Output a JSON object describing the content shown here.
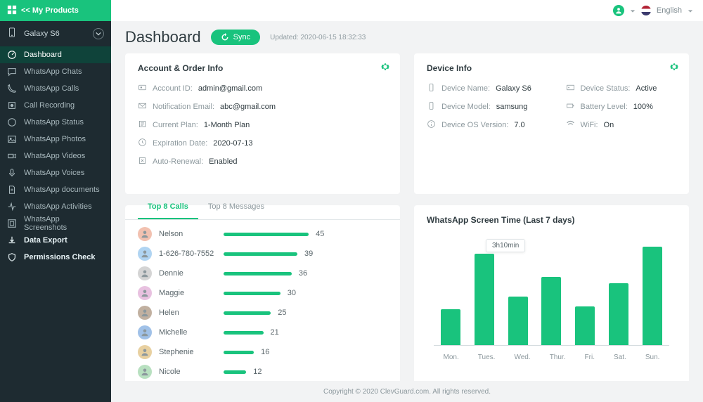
{
  "sidebar": {
    "top_label": "<< My Products",
    "device_label": "Galaxy S6",
    "items": [
      {
        "label": "Dashboard",
        "icon": "gauge",
        "active": true
      },
      {
        "label": "WhatsApp Chats",
        "icon": "chat"
      },
      {
        "label": "WhatsApp Calls",
        "icon": "phone"
      },
      {
        "label": "Call Recording",
        "icon": "record"
      },
      {
        "label": "WhatsApp Status",
        "icon": "status"
      },
      {
        "label": "WhatsApp Photos",
        "icon": "photo"
      },
      {
        "label": "WhatsApp Videos",
        "icon": "video"
      },
      {
        "label": "WhatsApp Voices",
        "icon": "mic"
      },
      {
        "label": "WhatsApp documents",
        "icon": "doc"
      },
      {
        "label": "WhatsApp Activities",
        "icon": "activity"
      },
      {
        "label": "WhatsApp Screenshots",
        "icon": "screenshot"
      },
      {
        "label": "Data Export",
        "icon": "export",
        "bold": true
      },
      {
        "label": "Permissions Check",
        "icon": "shield",
        "bold": true
      }
    ]
  },
  "topbar": {
    "language": "English"
  },
  "header": {
    "title": "Dashboard",
    "sync_label": "Sync",
    "updated_label": "Updated: 2020-06-15 18:32:33"
  },
  "account_card": {
    "title": "Account & Order Info",
    "rows": [
      {
        "label": "Account ID:",
        "value": "admin@gmail.com",
        "icon": "id"
      },
      {
        "label": "Notification Email:",
        "value": "abc@gmail.com",
        "icon": "mail"
      },
      {
        "label": "Current Plan:",
        "value": "1-Month Plan",
        "icon": "plan"
      },
      {
        "label": "Expiration Date:",
        "value": "2020-07-13",
        "icon": "clock"
      },
      {
        "label": "Auto-Renewal:",
        "value": "Enabled",
        "icon": "renew"
      }
    ]
  },
  "device_card": {
    "title": "Device Info",
    "left": [
      {
        "label": "Device Name:",
        "value": "Galaxy S6",
        "icon": "phone"
      },
      {
        "label": "Device Model:",
        "value": "samsung",
        "icon": "phone"
      },
      {
        "label": "Device OS Version:",
        "value": "7.0",
        "icon": "info"
      }
    ],
    "right": [
      {
        "label": "Device Status:",
        "value": "Active",
        "icon": "status"
      },
      {
        "label": "Battery Level:",
        "value": "100%",
        "icon": "battery"
      },
      {
        "label": "WiFi:",
        "value": "On",
        "icon": "wifi"
      }
    ]
  },
  "calls_card": {
    "tab1": "Top 8 Calls",
    "tab2": "Top 8 Messages",
    "max": 45,
    "rows": [
      {
        "name": "Nelson",
        "value": 45,
        "c": "c1"
      },
      {
        "name": "1-626-780-7552",
        "value": 39,
        "c": "c2"
      },
      {
        "name": "Dennie",
        "value": 36,
        "c": "c3"
      },
      {
        "name": "Maggie",
        "value": 30,
        "c": "c4"
      },
      {
        "name": "Helen",
        "value": 25,
        "c": "c5"
      },
      {
        "name": "Michelle",
        "value": 21,
        "c": "c6"
      },
      {
        "name": "Stephenie",
        "value": 16,
        "c": "c7"
      },
      {
        "name": "Nicole",
        "value": 12,
        "c": "c8"
      }
    ]
  },
  "screen_card": {
    "title": "WhatsApp Screen Time (Last 7 days)",
    "tooltip": "3h10min"
  },
  "chart_data": {
    "type": "bar",
    "title": "WhatsApp Screen Time (Last 7 days)",
    "categories": [
      "Mon.",
      "Tues.",
      "Wed.",
      "Thur.",
      "Fri.",
      "Sat.",
      "Sun."
    ],
    "values": [
      55,
      140,
      75,
      105,
      60,
      95,
      150
    ],
    "ylim": [
      0,
      160
    ],
    "tooltip": {
      "index": 1,
      "text": "3h10min"
    },
    "xlabel": "",
    "ylabel": ""
  },
  "footer": "Copyright © 2020 ClevGuard.com. All rights reserved."
}
